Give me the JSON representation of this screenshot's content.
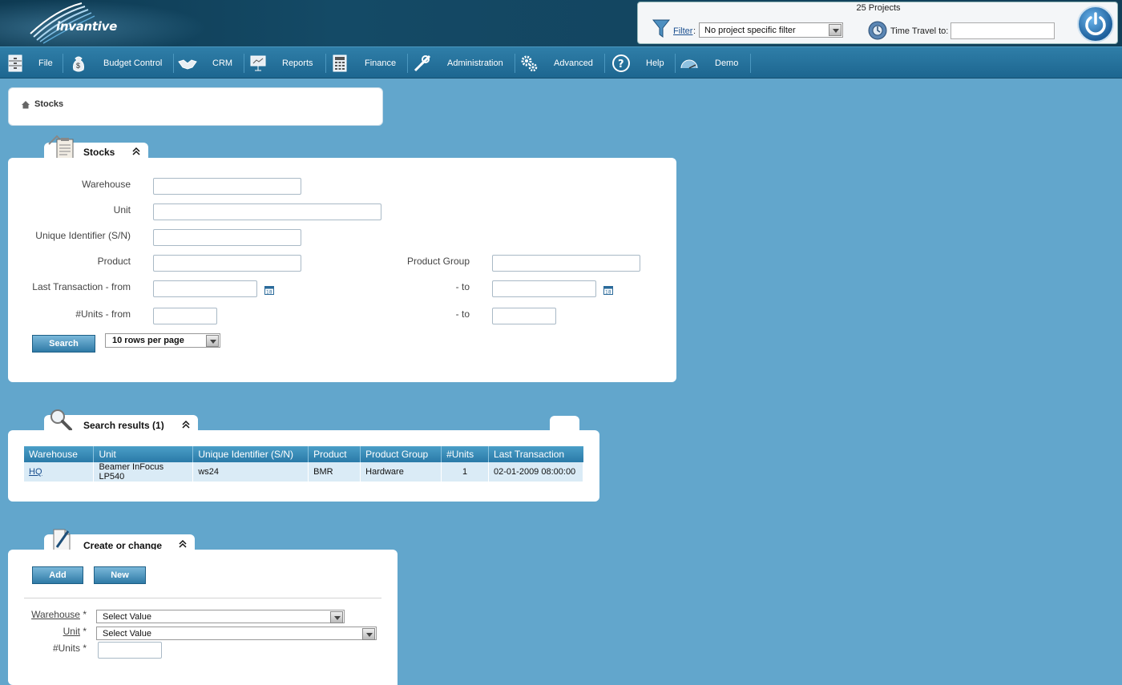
{
  "header": {
    "logo_text": "invantive",
    "projects_count": "25 Projects",
    "filter_link": "Filter",
    "filter_colon": ":",
    "filter_value": "No project specific filter",
    "time_travel_label": "Time Travel to:"
  },
  "menu": [
    {
      "label": "File",
      "icon": "cabinet-icon"
    },
    {
      "label": "Budget Control",
      "icon": "money-bag-icon"
    },
    {
      "label": "CRM",
      "icon": "handshake-icon"
    },
    {
      "label": "Reports",
      "icon": "presentation-icon"
    },
    {
      "label": "Finance",
      "icon": "calculator-icon"
    },
    {
      "label": "Administration",
      "icon": "tools-icon"
    },
    {
      "label": "Advanced",
      "icon": "gears-icon"
    },
    {
      "label": "Help",
      "icon": "help-icon"
    },
    {
      "label": "Demo",
      "icon": "speedometer-icon"
    }
  ],
  "breadcrumb": {
    "current": "Stocks"
  },
  "stocks_panel": {
    "title": "Stocks",
    "fields": {
      "warehouse": "Warehouse",
      "unit": "Unit",
      "unique_id": "Unique Identifier (S/N)",
      "product": "Product",
      "product_group": "Product Group",
      "last_tx_from": "Last Transaction - from",
      "last_tx_to": "- to",
      "units_from": "#Units - from",
      "units_to": "- to"
    },
    "search_button": "Search",
    "rows_per_page": "10 rows per page"
  },
  "results_panel": {
    "title": "Search results (1)",
    "columns": [
      "Warehouse",
      "Unit",
      "Unique Identifier (S/N)",
      "Product",
      "Product Group",
      "#Units",
      "Last Transaction"
    ],
    "rows": [
      [
        "HQ",
        "Beamer InFocus LP540",
        "ws24",
        "BMR",
        "Hardware",
        "1",
        "02-01-2009 08:00:00"
      ]
    ]
  },
  "create_panel": {
    "title": "Create or change",
    "add_button": "Add",
    "new_button": "New",
    "warehouse_label": "Warehouse",
    "unit_label": "Unit",
    "units_label": "#Units",
    "required_mark": "*",
    "warehouse_value": "Select Value",
    "unit_value": "Select Value"
  },
  "colors": {
    "background": "#62a6cc",
    "menu": "#1d6690",
    "header": "#144a66",
    "accent": "#2f7aa6"
  }
}
